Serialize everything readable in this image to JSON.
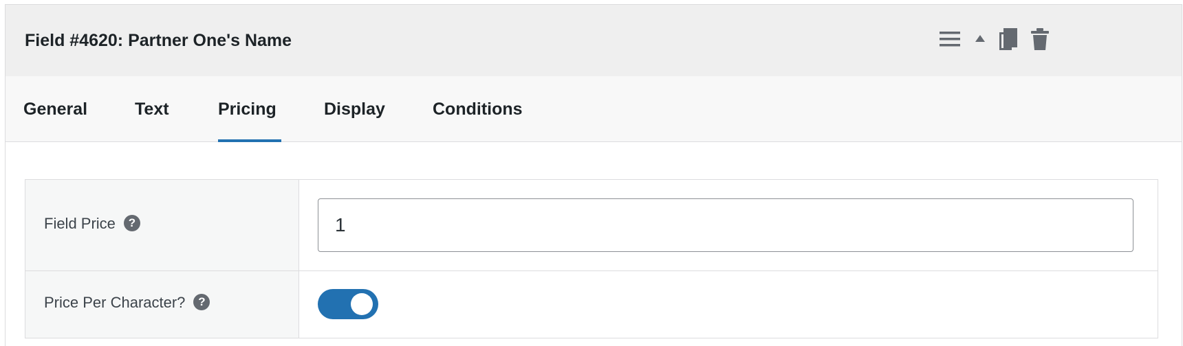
{
  "header": {
    "title": "Field #4620: Partner One's Name",
    "icons": [
      "menu-icon",
      "collapse-arrow-icon",
      "duplicate-icon",
      "trash-icon"
    ]
  },
  "tabs": [
    {
      "label": "General",
      "active": false
    },
    {
      "label": "Text",
      "active": false
    },
    {
      "label": "Pricing",
      "active": true
    },
    {
      "label": "Display",
      "active": false
    },
    {
      "label": "Conditions",
      "active": false
    }
  ],
  "fields": {
    "field_price": {
      "label": "Field Price",
      "help": "?",
      "value": "1"
    },
    "price_per_character": {
      "label": "Price Per Character?",
      "help": "?",
      "enabled": true
    }
  },
  "colors": {
    "accent": "#2271b1",
    "header_bg": "#efefef",
    "tabs_bg": "#f8f8f8",
    "label_bg": "#f6f7f7",
    "icon": "#646970"
  }
}
